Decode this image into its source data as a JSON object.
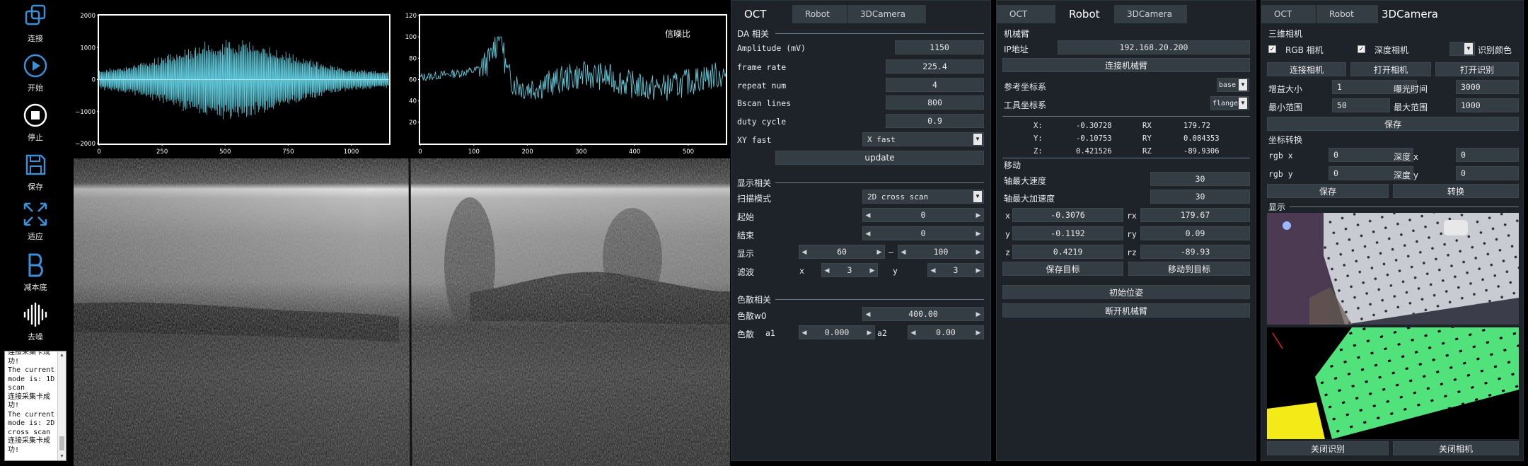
{
  "toolbar": {
    "items": [
      {
        "label": "连接",
        "icon": "connect-icon"
      },
      {
        "label": "开始",
        "icon": "play-icon"
      },
      {
        "label": "停止",
        "icon": "stop-icon"
      },
      {
        "label": "保存",
        "icon": "save-icon"
      },
      {
        "label": "适应",
        "icon": "fit-icon"
      },
      {
        "label": "减本底",
        "icon": "background-subtract-icon"
      },
      {
        "label": "去噪",
        "icon": "denoise-icon"
      }
    ]
  },
  "log": {
    "text": "连接采集卡成功!\nThe current mode is: 1D scan\n连接采集卡成功!\nThe current mode is: 2D cross scan\n连接采集卡成功!"
  },
  "signal_plot": {
    "chart_data": {
      "type": "line",
      "xlim": [
        0,
        1150
      ],
      "ylim": [
        -2000,
        2000
      ],
      "xticks": [
        "0",
        "250",
        "500",
        "750",
        "1000"
      ],
      "yticks": [
        "2000",
        "1000",
        "0",
        "−1000",
        "−2000"
      ],
      "color": "#5fc7d8"
    }
  },
  "snr_plot": {
    "chart_data": {
      "type": "line",
      "label": "信噪比",
      "xlim": [
        0,
        570
      ],
      "ylim": [
        0,
        120
      ],
      "xticks": [
        "0",
        "100",
        "200",
        "300",
        "400",
        "500"
      ],
      "yticks": [
        "120",
        "100",
        "80",
        "60",
        "40",
        "20"
      ],
      "color": "#5fc7d8"
    }
  },
  "oct_panel": {
    "tabs": [
      "OCT",
      "Robot",
      "3DCamera"
    ],
    "da_title": "DA 相关",
    "amplitude_label": "Amplitude (mV)",
    "amplitude": "1150",
    "frame_rate_label": "frame rate",
    "frame_rate": "225.4",
    "repeat_label": "repeat num",
    "repeat": "4",
    "bscan_label": "Bscan lines",
    "bscan": "800",
    "duty_label": "duty cycle",
    "duty": "0.9",
    "xy_label": "XY fast",
    "xy_value": "X fast",
    "update_label": "update",
    "display_title": "显示相关",
    "scan_mode_label": "扫描模式",
    "scan_mode": "2D cross scan",
    "start_label": "起始",
    "start": "0",
    "end_label": "结束",
    "end": "0",
    "show_label": "显示",
    "show_min": "60",
    "dash": "–",
    "show_max": "100",
    "filter_label": "滤波",
    "filter_x_label": "x",
    "filter_x": "3",
    "filter_y_label": "y",
    "filter_y": "3",
    "disp_title": "色散相关",
    "disp_w0_label": "色散w0",
    "disp_w0": "400.00",
    "disp_label": "色散",
    "a1_label": "a1",
    "a1": "0.000",
    "a2_label": "a2",
    "a2": "0.00"
  },
  "robot_panel": {
    "tabs": [
      "OCT",
      "Robot",
      "3DCamera"
    ],
    "arm_title": "机械臂",
    "ip_label": "IP地址",
    "ip": "192.168.20.200",
    "connect_label": "连接机械臂",
    "ref_label": "参考坐标系",
    "ref_value": "base",
    "tool_label": "工具坐标系",
    "tool_value": "flange",
    "pose": [
      {
        "k": "X:",
        "v": "-0.30728",
        "rk": "RX",
        "rv": "179.72"
      },
      {
        "k": "Y:",
        "v": "-0.10753",
        "rk": "RY",
        "rv": "0.084353"
      },
      {
        "k": "Z:",
        "v": "0.421526",
        "rk": "RZ",
        "rv": "-89.9306"
      }
    ],
    "move_title": "移动",
    "max_speed_label": "轴最大速度",
    "max_speed": "30",
    "max_acc_label": "轴最大加速度",
    "max_acc": "30",
    "targets": [
      {
        "k": "x",
        "v": "-0.3076",
        "rk": "rx",
        "rv": "179.67"
      },
      {
        "k": "y",
        "v": "-0.1192",
        "rk": "ry",
        "rv": "0.09"
      },
      {
        "k": "z",
        "v": "0.4219",
        "rk": "rz",
        "rv": "-89.93"
      }
    ],
    "save_target_label": "保存目标",
    "move_target_label": "移动到目标",
    "init_pose_label": "初始位姿",
    "disconnect_label": "断开机械臂"
  },
  "camera_panel": {
    "tabs": [
      "OCT",
      "Robot",
      "3DCamera"
    ],
    "cam_title": "三维相机",
    "rgb_label": "RGB 相机",
    "depth_label": "深度相机",
    "color_id_label": "识别颜色",
    "connect_label": "连接相机",
    "open_label": "打开相机",
    "open_detect_label": "打开识别",
    "gain_label": "增益大小",
    "gain": "1",
    "exposure_label": "曝光时间",
    "exposure": "3000",
    "min_range_label": "最小范围",
    "min_range": "50",
    "max_range_label": "最大范围",
    "max_range": "1000",
    "save_label": "保存",
    "coord_title": "坐标转换",
    "rgbx_label": "rgb x",
    "rgbx": "0",
    "depthx_label": "深度 x",
    "depthx": "0",
    "rgby_label": "rgb y",
    "rgby": "0",
    "depthy_label": "深度 y",
    "depthy": "0",
    "save2_label": "保存",
    "convert_label": "转换",
    "display_title": "显示",
    "close_detect_label": "关闭识别",
    "close_cam_label": "关闭相机"
  }
}
